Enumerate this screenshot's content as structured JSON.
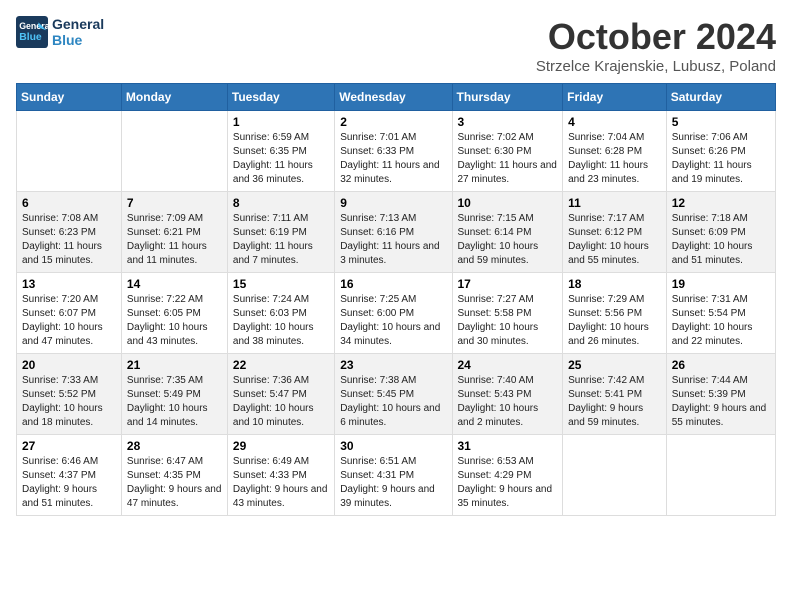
{
  "header": {
    "logo_line1": "General",
    "logo_line2": "Blue",
    "month": "October 2024",
    "location": "Strzelce Krajenskie, Lubusz, Poland"
  },
  "days_of_week": [
    "Sunday",
    "Monday",
    "Tuesday",
    "Wednesday",
    "Thursday",
    "Friday",
    "Saturday"
  ],
  "weeks": [
    [
      {
        "day": "",
        "info": ""
      },
      {
        "day": "",
        "info": ""
      },
      {
        "day": "1",
        "info": "Sunrise: 6:59 AM\nSunset: 6:35 PM\nDaylight: 11 hours and 36 minutes."
      },
      {
        "day": "2",
        "info": "Sunrise: 7:01 AM\nSunset: 6:33 PM\nDaylight: 11 hours and 32 minutes."
      },
      {
        "day": "3",
        "info": "Sunrise: 7:02 AM\nSunset: 6:30 PM\nDaylight: 11 hours and 27 minutes."
      },
      {
        "day": "4",
        "info": "Sunrise: 7:04 AM\nSunset: 6:28 PM\nDaylight: 11 hours and 23 minutes."
      },
      {
        "day": "5",
        "info": "Sunrise: 7:06 AM\nSunset: 6:26 PM\nDaylight: 11 hours and 19 minutes."
      }
    ],
    [
      {
        "day": "6",
        "info": "Sunrise: 7:08 AM\nSunset: 6:23 PM\nDaylight: 11 hours and 15 minutes."
      },
      {
        "day": "7",
        "info": "Sunrise: 7:09 AM\nSunset: 6:21 PM\nDaylight: 11 hours and 11 minutes."
      },
      {
        "day": "8",
        "info": "Sunrise: 7:11 AM\nSunset: 6:19 PM\nDaylight: 11 hours and 7 minutes."
      },
      {
        "day": "9",
        "info": "Sunrise: 7:13 AM\nSunset: 6:16 PM\nDaylight: 11 hours and 3 minutes."
      },
      {
        "day": "10",
        "info": "Sunrise: 7:15 AM\nSunset: 6:14 PM\nDaylight: 10 hours and 59 minutes."
      },
      {
        "day": "11",
        "info": "Sunrise: 7:17 AM\nSunset: 6:12 PM\nDaylight: 10 hours and 55 minutes."
      },
      {
        "day": "12",
        "info": "Sunrise: 7:18 AM\nSunset: 6:09 PM\nDaylight: 10 hours and 51 minutes."
      }
    ],
    [
      {
        "day": "13",
        "info": "Sunrise: 7:20 AM\nSunset: 6:07 PM\nDaylight: 10 hours and 47 minutes."
      },
      {
        "day": "14",
        "info": "Sunrise: 7:22 AM\nSunset: 6:05 PM\nDaylight: 10 hours and 43 minutes."
      },
      {
        "day": "15",
        "info": "Sunrise: 7:24 AM\nSunset: 6:03 PM\nDaylight: 10 hours and 38 minutes."
      },
      {
        "day": "16",
        "info": "Sunrise: 7:25 AM\nSunset: 6:00 PM\nDaylight: 10 hours and 34 minutes."
      },
      {
        "day": "17",
        "info": "Sunrise: 7:27 AM\nSunset: 5:58 PM\nDaylight: 10 hours and 30 minutes."
      },
      {
        "day": "18",
        "info": "Sunrise: 7:29 AM\nSunset: 5:56 PM\nDaylight: 10 hours and 26 minutes."
      },
      {
        "day": "19",
        "info": "Sunrise: 7:31 AM\nSunset: 5:54 PM\nDaylight: 10 hours and 22 minutes."
      }
    ],
    [
      {
        "day": "20",
        "info": "Sunrise: 7:33 AM\nSunset: 5:52 PM\nDaylight: 10 hours and 18 minutes."
      },
      {
        "day": "21",
        "info": "Sunrise: 7:35 AM\nSunset: 5:49 PM\nDaylight: 10 hours and 14 minutes."
      },
      {
        "day": "22",
        "info": "Sunrise: 7:36 AM\nSunset: 5:47 PM\nDaylight: 10 hours and 10 minutes."
      },
      {
        "day": "23",
        "info": "Sunrise: 7:38 AM\nSunset: 5:45 PM\nDaylight: 10 hours and 6 minutes."
      },
      {
        "day": "24",
        "info": "Sunrise: 7:40 AM\nSunset: 5:43 PM\nDaylight: 10 hours and 2 minutes."
      },
      {
        "day": "25",
        "info": "Sunrise: 7:42 AM\nSunset: 5:41 PM\nDaylight: 9 hours and 59 minutes."
      },
      {
        "day": "26",
        "info": "Sunrise: 7:44 AM\nSunset: 5:39 PM\nDaylight: 9 hours and 55 minutes."
      }
    ],
    [
      {
        "day": "27",
        "info": "Sunrise: 6:46 AM\nSunset: 4:37 PM\nDaylight: 9 hours and 51 minutes."
      },
      {
        "day": "28",
        "info": "Sunrise: 6:47 AM\nSunset: 4:35 PM\nDaylight: 9 hours and 47 minutes."
      },
      {
        "day": "29",
        "info": "Sunrise: 6:49 AM\nSunset: 4:33 PM\nDaylight: 9 hours and 43 minutes."
      },
      {
        "day": "30",
        "info": "Sunrise: 6:51 AM\nSunset: 4:31 PM\nDaylight: 9 hours and 39 minutes."
      },
      {
        "day": "31",
        "info": "Sunrise: 6:53 AM\nSunset: 4:29 PM\nDaylight: 9 hours and 35 minutes."
      },
      {
        "day": "",
        "info": ""
      },
      {
        "day": "",
        "info": ""
      }
    ]
  ]
}
